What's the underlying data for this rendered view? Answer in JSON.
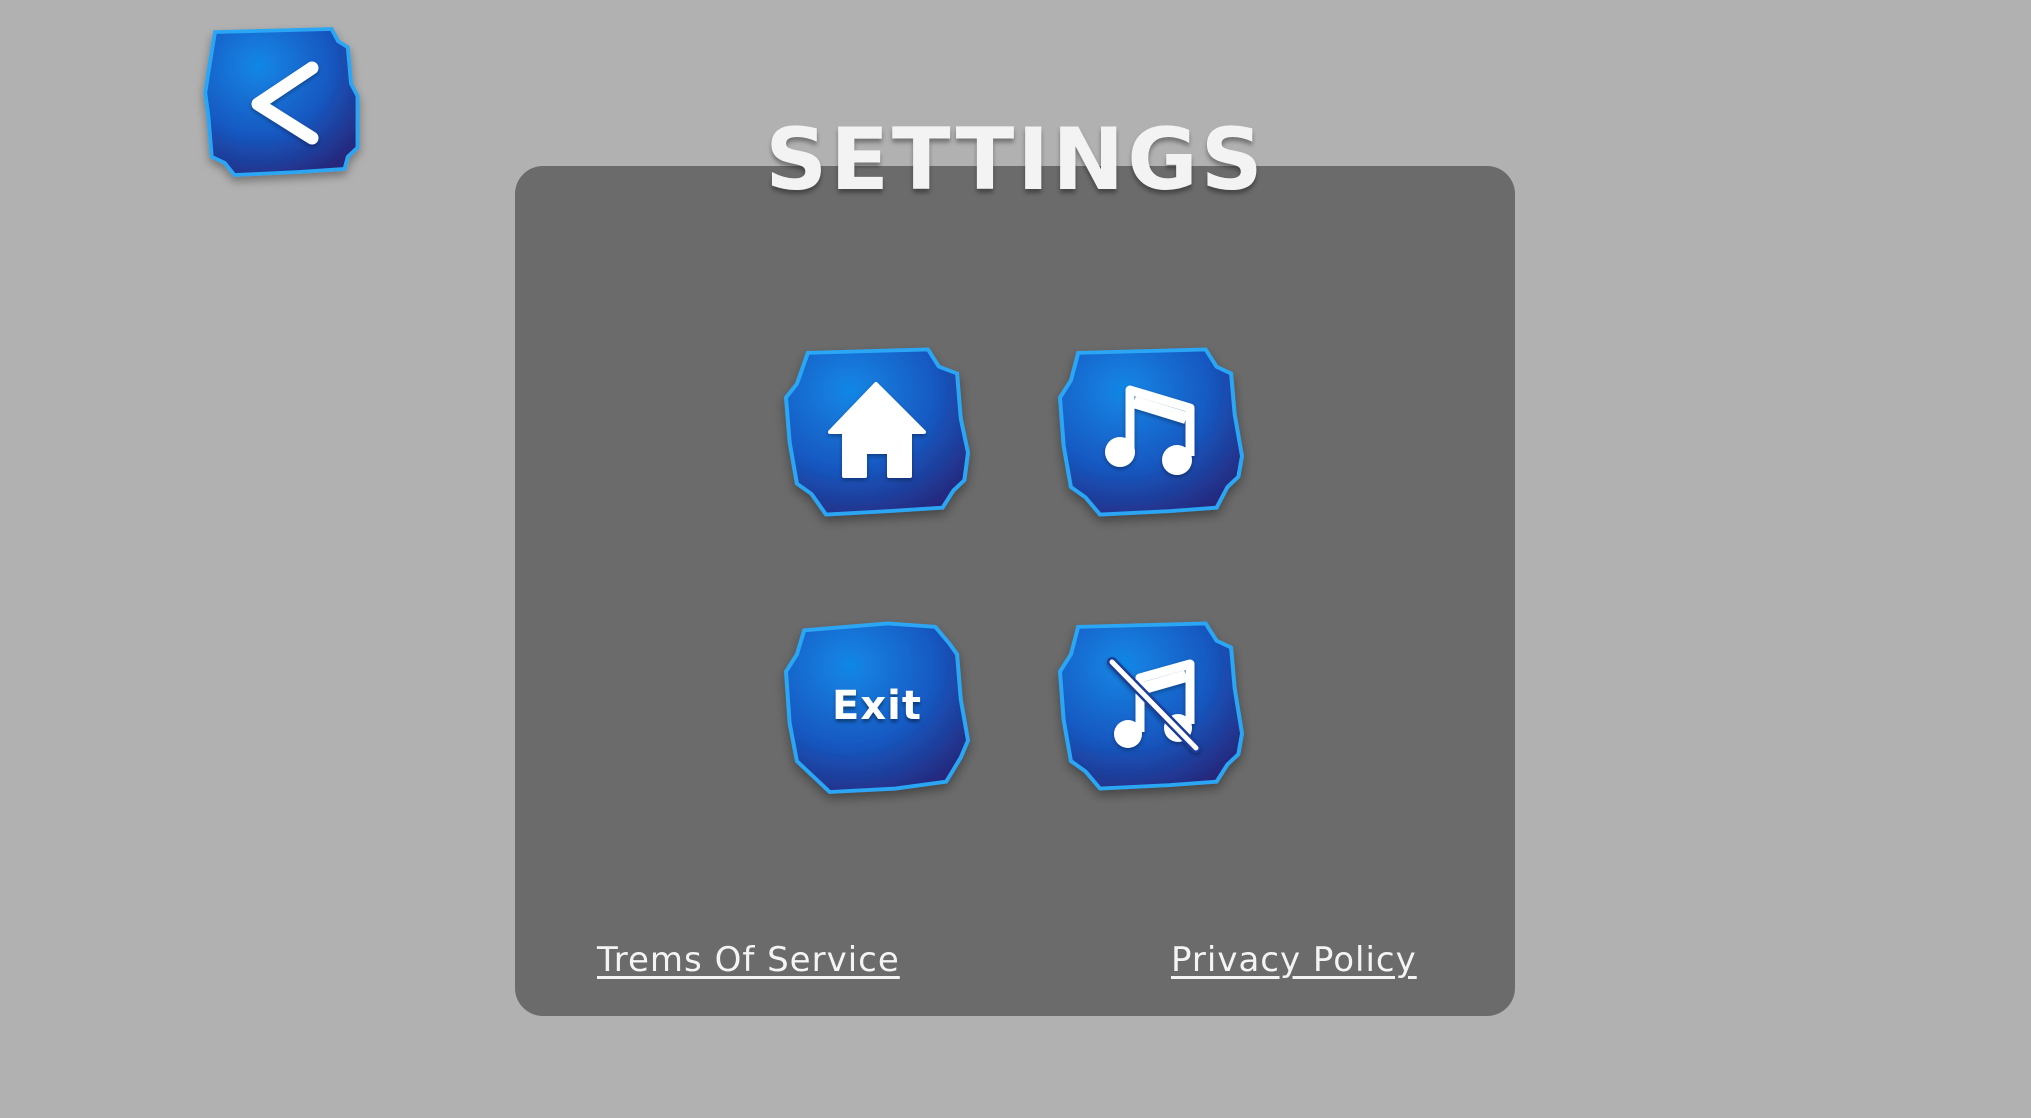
{
  "screen": {
    "title": "SETTINGS"
  },
  "buttons": {
    "back_icon": "chevron-left-icon",
    "home_icon": "home-icon",
    "music_icon": "music-note-icon",
    "exit_label": "Exit",
    "mute_icon": "music-off-icon"
  },
  "links": {
    "terms": "Trems Of Service",
    "privacy": "Privacy Policy"
  },
  "colors": {
    "background": "#b1b1b1",
    "panel": "#6b6b6b",
    "button_light": "#0f7ee0",
    "button_dark": "#23287d",
    "button_border": "#2aa6f5",
    "text": "#f3f3f3"
  }
}
